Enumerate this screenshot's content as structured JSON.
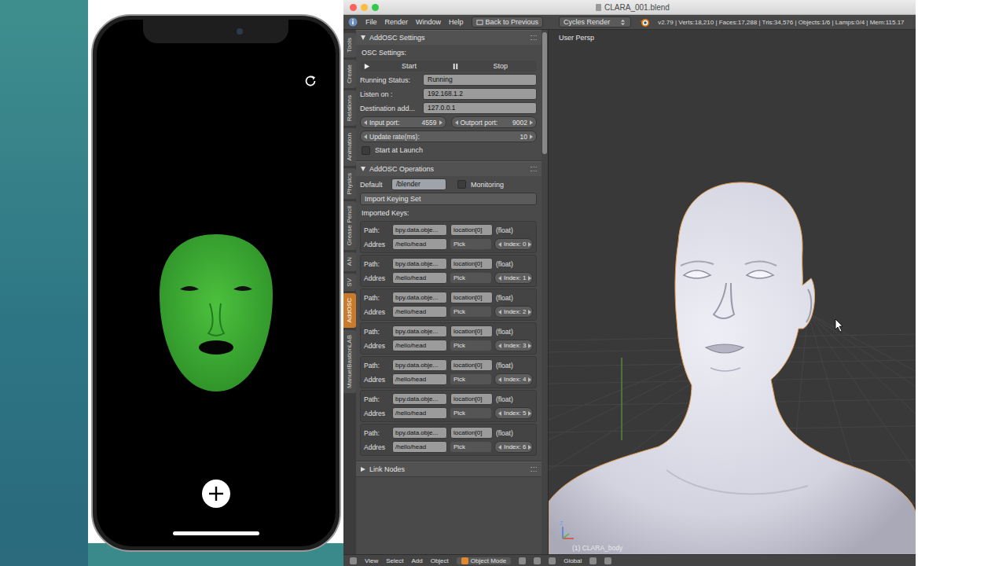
{
  "window": {
    "title": "CLARA_001.blend"
  },
  "menu": [
    {
      "label": "File"
    },
    {
      "label": "Render"
    },
    {
      "label": "Window"
    },
    {
      "label": "Help"
    }
  ],
  "back_button": "Back to Previous",
  "render_engine": "Cycles Render",
  "stats": "v2.79 | Verts:18,210 | Faces:17,288 | Tris:34,576 | Objects:1/6 | Lamps:0/4 | Mem:115.17",
  "tabs": [
    {
      "label": "Tools",
      "selected": false
    },
    {
      "label": "Create",
      "selected": false
    },
    {
      "label": "Relations",
      "selected": false
    },
    {
      "label": "Animation",
      "selected": false
    },
    {
      "label": "Physics",
      "selected": false
    },
    {
      "label": "Grease Pencil",
      "selected": false
    },
    {
      "label": "AN",
      "selected": false
    },
    {
      "label": "SV",
      "selected": false
    },
    {
      "label": "AddOSC",
      "selected": true
    },
    {
      "label": "ManuelBastionLAB",
      "selected": false
    }
  ],
  "settings": {
    "title": "AddOSC Settings",
    "expanded": true,
    "section": "OSC Settings:",
    "start": "Start",
    "stop": "Stop",
    "fields": [
      {
        "label": "Running Status:",
        "value": "Running"
      },
      {
        "label": "Listen on :",
        "value": "192.168.1.2"
      },
      {
        "label": "Destination add...",
        "value": "127.0.0.1"
      }
    ],
    "ports": [
      {
        "label": "Input port:",
        "value": "4559"
      },
      {
        "label": "Outport port:",
        "value": "9002"
      }
    ],
    "update_rate": {
      "label": "Update rate(ms):",
      "value": "10"
    },
    "start_at_launch": {
      "label": "Start at Launch",
      "checked": false
    }
  },
  "operations": {
    "title": "AddOSC Operations",
    "expanded": true,
    "default_label": "Default",
    "default_value": "/blender",
    "monitoring": {
      "label": "Monitoring",
      "checked": false
    },
    "import_button": "Import Keying Set",
    "keys_label": "Imported Keys:",
    "keys": [
      {
        "path_label": "Path:",
        "path": "bpy.data.obje...",
        "prop": "location[0]",
        "type": "(float)",
        "address_label": "Addres",
        "address": "/hello/head",
        "pick": "Pick",
        "index": "Index: 0"
      },
      {
        "path_label": "Path:",
        "path": "bpy.data.obje...",
        "prop": "location[0]",
        "type": "(float)",
        "address_label": "Addres",
        "address": "/hello/head",
        "pick": "Pick",
        "index": "Index: 1"
      },
      {
        "path_label": "Path:",
        "path": "bpy.data.obje...",
        "prop": "location[0]",
        "type": "(float)",
        "address_label": "Addres",
        "address": "/hello/head",
        "pick": "Pick",
        "index": "Index: 2"
      },
      {
        "path_label": "Path:",
        "path": "bpy.data.obje...",
        "prop": "location[0]",
        "type": "(float)",
        "address_label": "Addres",
        "address": "/hello/head",
        "pick": "Pick",
        "index": "Index: 3"
      },
      {
        "path_label": "Path:",
        "path": "bpy.data.obje...",
        "prop": "location[0]",
        "type": "(float)",
        "address_label": "Addres",
        "address": "/hello/head",
        "pick": "Pick",
        "index": "Index: 4"
      },
      {
        "path_label": "Path:",
        "path": "bpy.data.obje...",
        "prop": "location[0]",
        "type": "(float)",
        "address_label": "Addres",
        "address": "/hello/head",
        "pick": "Pick",
        "index": "Index: 5"
      },
      {
        "path_label": "Path:",
        "path": "bpy.data.obje...",
        "prop": "location[0]",
        "type": "(float)",
        "address_label": "Addres",
        "address": "/hello/head",
        "pick": "Pick",
        "index": "Index: 6"
      }
    ]
  },
  "link_nodes": {
    "title": "Link Nodes",
    "expanded": false
  },
  "viewport": {
    "view_label": "User Persp",
    "object_label": "(1) CLARA_body",
    "axis_label": "z"
  },
  "footer": {
    "menu": [
      "View",
      "Select",
      "Add",
      "Object"
    ],
    "mode": "Object Mode",
    "orientation": "Global"
  }
}
